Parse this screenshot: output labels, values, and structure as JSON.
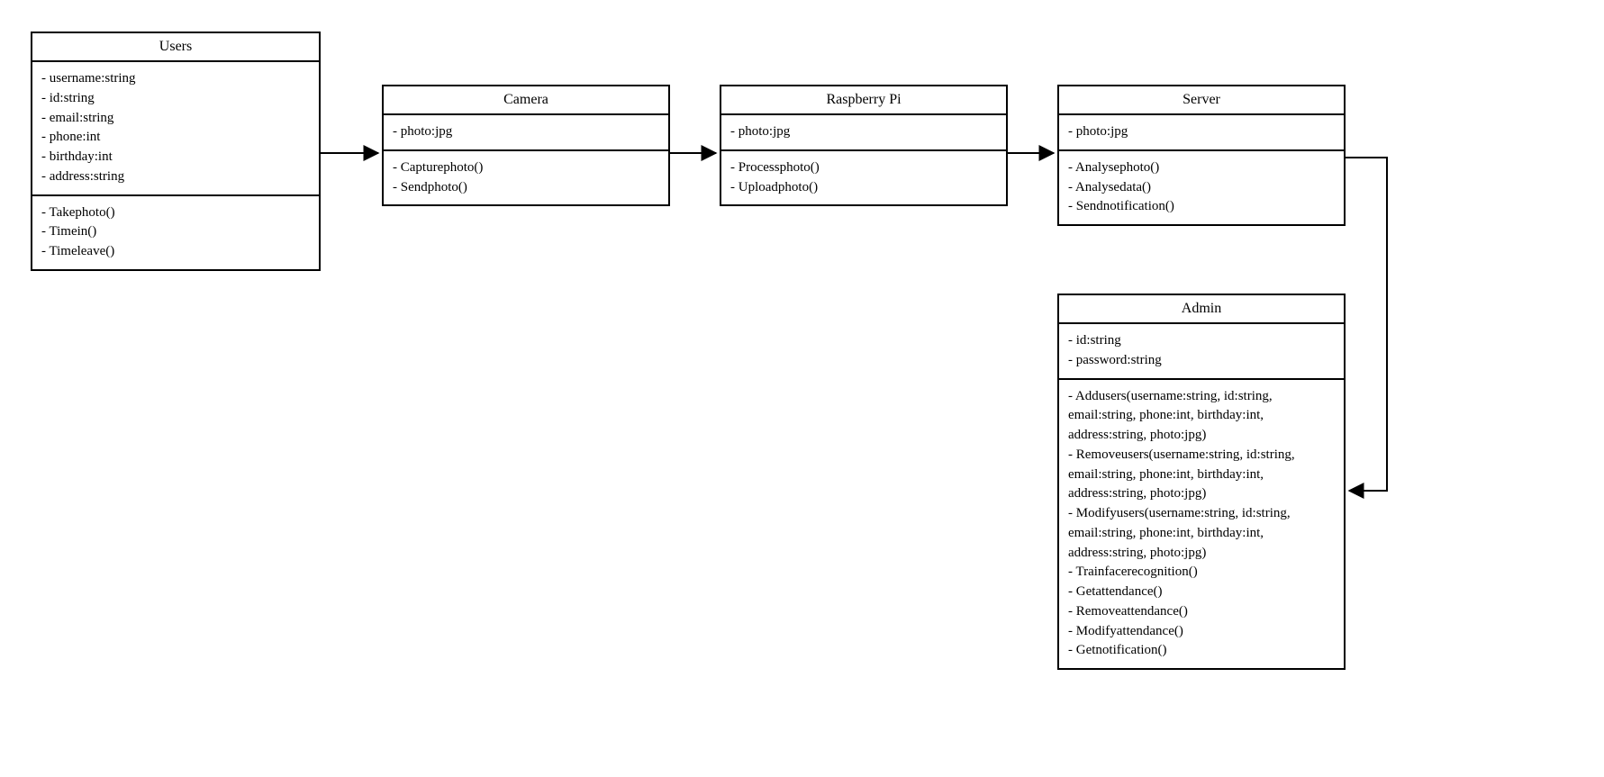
{
  "classes": {
    "users": {
      "title": "Users",
      "attributes": [
        "- username:string",
        "- id:string",
        "- email:string",
        "- phone:int",
        "- birthday:int",
        "- address:string"
      ],
      "methods": [
        "- Takephoto()",
        "- Timein()",
        "- Timeleave()"
      ]
    },
    "camera": {
      "title": "Camera",
      "attributes": [
        "- photo:jpg"
      ],
      "methods": [
        "- Capturephoto()",
        "- Sendphoto()"
      ]
    },
    "raspberry": {
      "title": "Raspberry Pi",
      "attributes": [
        "- photo:jpg"
      ],
      "methods": [
        "- Processphoto()",
        "- Uploadphoto()"
      ]
    },
    "server": {
      "title": "Server",
      "attributes": [
        "- photo:jpg"
      ],
      "methods": [
        "- Analysephoto()",
        "- Analysedata()",
        "- Sendnotification()"
      ]
    },
    "admin": {
      "title": "Admin",
      "attributes": [
        "- id:string",
        "- password:string"
      ],
      "methods": [
        "- Addusers(username:string, id:string, email:string, phone:int, birthday:int, address:string, photo:jpg)",
        "- Removeusers(username:string, id:string, email:string, phone:int, birthday:int, address:string, photo:jpg)",
        "- Modifyusers(username:string, id:string, email:string, phone:int, birthday:int, address:string, photo:jpg)",
        "- Trainfacerecognition()",
        "- Getattendance()",
        "- Removeattendance()",
        "- Modifyattendance()",
        "- Getnotification()"
      ]
    }
  }
}
